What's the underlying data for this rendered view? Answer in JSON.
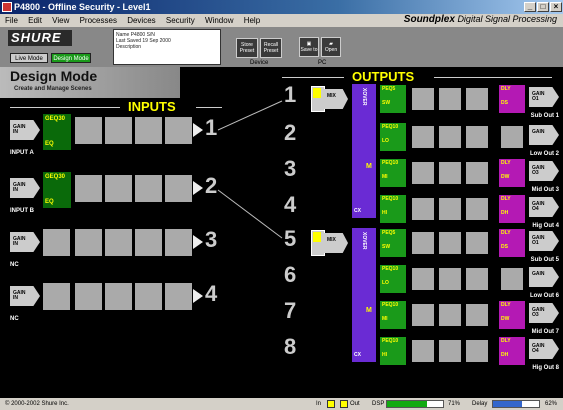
{
  "window": {
    "title": "P4800 - Offline Security - Level1"
  },
  "menu": [
    "File",
    "Edit",
    "View",
    "Processes",
    "Devices",
    "Security",
    "Window",
    "Help"
  ],
  "brand": {
    "logo": "SHURE",
    "product": "Soundplex",
    "tagline": "Digital Signal Processing"
  },
  "toolbar": {
    "live_mode": "Live Mode",
    "design_mode": "Design Mode",
    "info_lines": [
      "Name P4800 S/N",
      "Last Saved 19 Sep 2000",
      "Description"
    ],
    "store_preset": "Store Preset",
    "recall_preset": "Recall Preset",
    "save_to": "Save to",
    "open": "Open",
    "device_group": "Device",
    "pc_group": "PC"
  },
  "design": {
    "title": "Design Mode",
    "subtitle": "Create and Manage Scenes"
  },
  "inputs": {
    "header": "INPUTS",
    "channels": [
      {
        "num": "1",
        "gain": "GAIN",
        "module": "GEQ30",
        "module_sub": "EQ",
        "name": "INPUT A",
        "has_module": true
      },
      {
        "num": "2",
        "gain": "GAIN",
        "module": "GEQ30",
        "module_sub": "EQ",
        "name": "INPUT B",
        "has_module": true
      },
      {
        "num": "3",
        "gain": "GAIN",
        "module": "",
        "module_sub": "",
        "name": "NC",
        "has_module": false
      },
      {
        "num": "4",
        "gain": "GAIN",
        "module": "",
        "module_sub": "",
        "name": "NC",
        "has_module": false
      }
    ]
  },
  "outputs": {
    "header": "OUTPUTS",
    "mixer_label": "MIX",
    "xover_label": "XOVER",
    "xover_cx": "CX",
    "xover_m": "M",
    "channels": [
      {
        "num": "1",
        "peq": "PEQ5",
        "peq_sub": "SW",
        "dly": "DLY",
        "dly_sub": "DS",
        "gain": "GAIN",
        "gain_sub": "O1",
        "name": "Sub Out 1",
        "has_dly": true
      },
      {
        "num": "2",
        "peq": "PEQ10",
        "peq_sub": "LO",
        "dly": "",
        "dly_sub": "",
        "gain": "GAIN",
        "gain_sub": "",
        "name": "Low Out 2",
        "has_dly": false
      },
      {
        "num": "3",
        "peq": "PEQ10",
        "peq_sub": "MI",
        "dly": "DLY",
        "dly_sub": "DW",
        "gain": "GAIN",
        "gain_sub": "O3",
        "name": "Mid Out 3",
        "has_dly": true
      },
      {
        "num": "4",
        "peq": "PEQ10",
        "peq_sub": "HI",
        "dly": "DLY",
        "dly_sub": "DH",
        "gain": "GAIN",
        "gain_sub": "O4",
        "name": "Hig Out 4",
        "has_dly": true
      },
      {
        "num": "5",
        "peq": "PEQ5",
        "peq_sub": "SW",
        "dly": "DLY",
        "dly_sub": "DS",
        "gain": "GAIN",
        "gain_sub": "O1",
        "name": "Sub Out 5",
        "has_dly": true
      },
      {
        "num": "6",
        "peq": "PEQ10",
        "peq_sub": "LO",
        "dly": "",
        "dly_sub": "",
        "gain": "GAIN",
        "gain_sub": "",
        "name": "Low Out 6",
        "has_dly": false
      },
      {
        "num": "7",
        "peq": "PEQ10",
        "peq_sub": "MI",
        "dly": "DLY",
        "dly_sub": "DW",
        "gain": "GAIN",
        "gain_sub": "O3",
        "name": "Mid Out 7",
        "has_dly": true
      },
      {
        "num": "8",
        "peq": "PEQ10",
        "peq_sub": "HI",
        "dly": "DLY",
        "dly_sub": "DH",
        "gain": "GAIN",
        "gain_sub": "O4",
        "name": "Hig Out 8",
        "has_dly": true
      }
    ]
  },
  "status": {
    "copyright": "© 2000-2002 Shure Inc.",
    "in_label": "In",
    "out_label": "Out",
    "dsp_label": "DSP",
    "dsp_percent_text": "71%",
    "dsp_level": 0.71,
    "delay_label": "Delay",
    "delay_percent_text": "62%",
    "delay_level": 0.62
  },
  "colors": {
    "header_yellow": "#ffff00",
    "eq_green": "#1a9a1a",
    "xover_purple": "#6a2bd4",
    "dly_magenta": "#b419b4"
  }
}
